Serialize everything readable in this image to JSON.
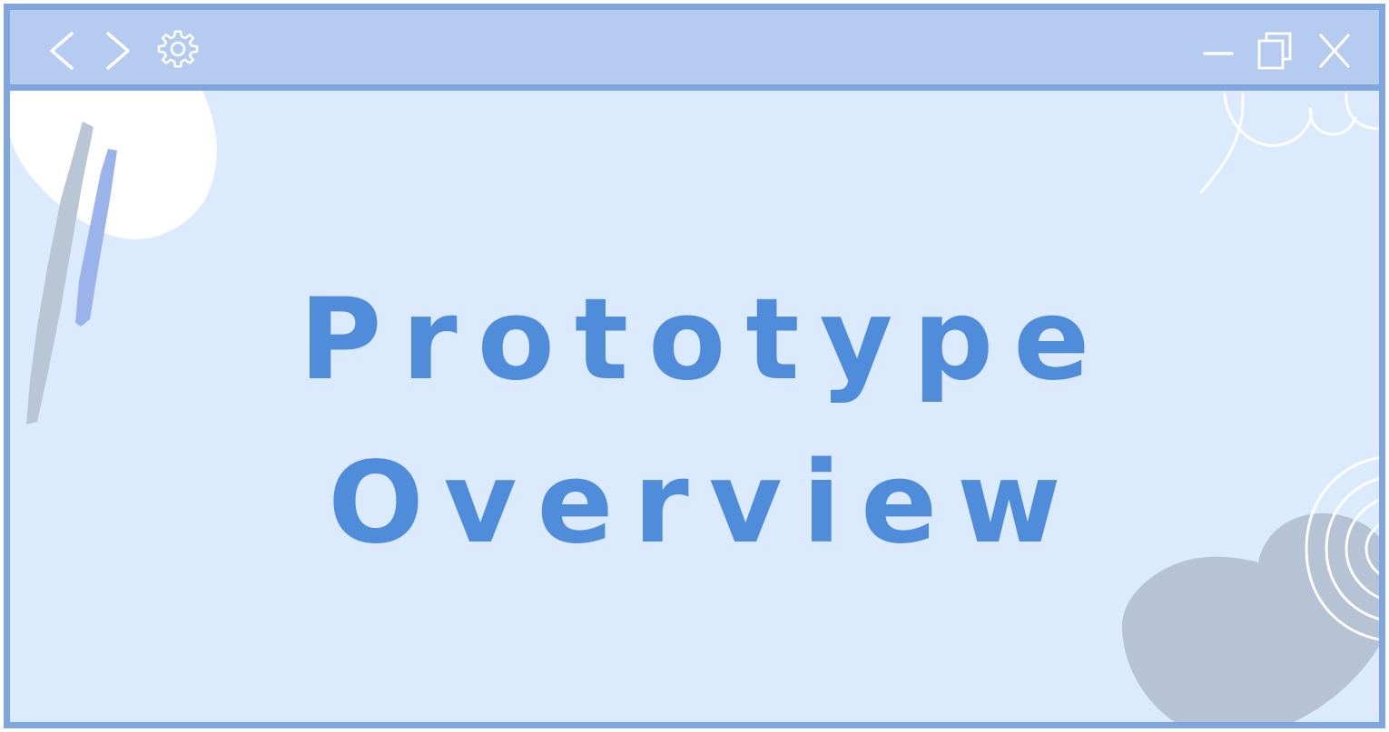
{
  "window": {
    "title_lines": [
      "Prototype",
      "Overview"
    ]
  },
  "toolbar": {
    "icons": {
      "back": "chevron-left-icon",
      "forward": "chevron-right-icon",
      "settings": "gear-icon",
      "minimize": "minimize-icon",
      "restore": "restore-icon",
      "close": "close-icon"
    }
  },
  "colors": {
    "frame": "#7fa6dd",
    "titlebar": "#b5cbef",
    "background": "#dbeafd",
    "title_text": "#4f8ddb",
    "blob_gray": "#b5c3d4",
    "stroke_blue": "#9bb3eb",
    "stroke_gray": "#b9c6d5",
    "white": "#ffffff"
  }
}
